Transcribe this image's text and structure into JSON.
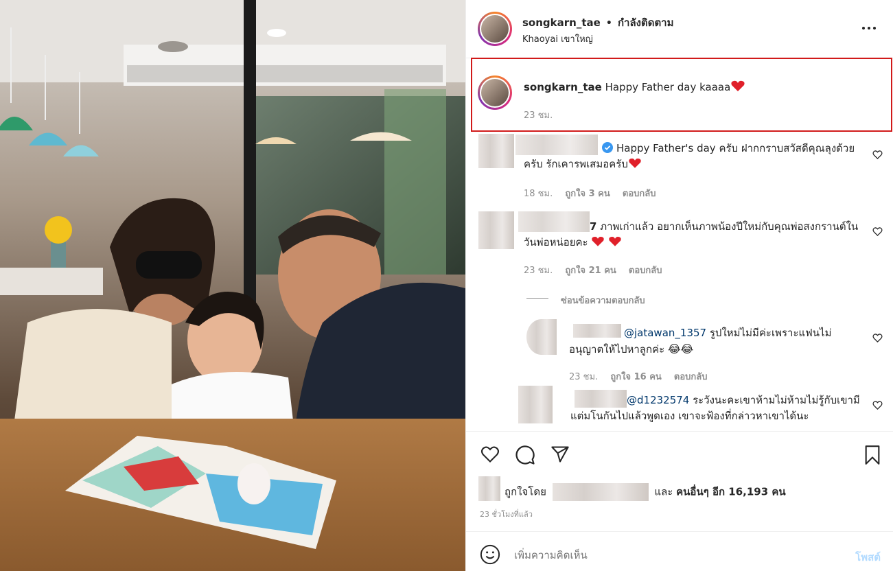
{
  "post": {
    "username": "songkarn_tae",
    "separator": "•",
    "follow_status": "กำลังติดตาม",
    "location": "Khaoyai เขาใหญ่",
    "caption": "Happy Father day kaaaa",
    "caption_time": "23 ชม."
  },
  "comments": [
    {
      "text": "Happy Father's day ครับ ฝากกราบสวัสดีคุณลุงด้วยครับ รักเคารพเสมอครับ",
      "time": "18 ชม.",
      "likes": "ถูกใจ 3 คน",
      "reply": "ตอบกลับ"
    },
    {
      "username_suffix": "7",
      "text": "ภาพเก่าแล้ว อยากเห็นภาพน้องปีใหม่กับคุณพ่อสงกรานต์ในวันพ่อหน่อยคะ",
      "time": "23 ชม.",
      "likes": "ถูกใจ 21 คน",
      "reply": "ตอบกลับ",
      "hide_replies": "ซ่อนข้อความตอบกลับ"
    },
    {
      "mention": "@jatawan_1357",
      "text": "รูปใหม่ไม่มีค่ะเพราะแฟนไม่อนุญาตให้ไปหาลูกค่ะ",
      "time": "23 ชม.",
      "likes": "ถูกใจ 16 คน",
      "reply": "ตอบกลับ"
    },
    {
      "mention": "@d1232574",
      "text": "ระวังนะคะเขาห้ามไม่ห้ามไม่รู้กับเขามีแต่มโนกันไปแล้วพูดเอง เขาจะฟ้องที่กล่าวหาเขาได้นะ"
    }
  ],
  "likes_line": {
    "prefix": "ถูกใจโดย",
    "conj": "และ",
    "others": "คนอื่นๆ อีก 16,193 คน"
  },
  "timestamp": "23 ชั่วโมงที่แล้ว",
  "add_comment": {
    "placeholder": "เพิ่มความคิดเห็น",
    "post_label": "โพสต์"
  },
  "colors": {
    "heart_red": "#e0202a",
    "verified_blue": "#3897f0",
    "post_button_disabled": "#b3dbff",
    "highlight_box": "#d11a1a"
  },
  "icons": [
    "more-options-icon",
    "verified-badge-icon",
    "heart-icon",
    "comment-icon",
    "share-icon",
    "bookmark-icon",
    "emoji-icon"
  ]
}
